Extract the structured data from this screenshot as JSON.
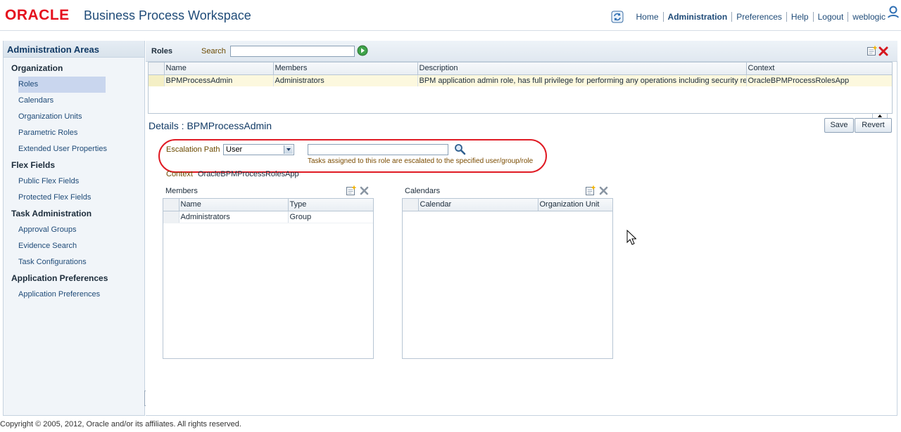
{
  "header": {
    "logo": "ORACLE",
    "app_title": "Business Process Workspace",
    "nav": {
      "home": "Home",
      "administration": "Administration",
      "preferences": "Preferences",
      "help": "Help",
      "logout": "Logout",
      "user": "weblogic"
    }
  },
  "sidebar": {
    "title": "Administration Areas",
    "sections": [
      {
        "title": "Organization",
        "items": [
          "Roles",
          "Calendars",
          "Organization Units",
          "Parametric Roles",
          "Extended User Properties"
        ]
      },
      {
        "title": "Flex Fields",
        "items": [
          "Public Flex Fields",
          "Protected Flex Fields"
        ]
      },
      {
        "title": "Task Administration",
        "items": [
          "Approval Groups",
          "Evidence Search",
          "Task Configurations"
        ]
      },
      {
        "title": "Application Preferences",
        "items": [
          "Application Preferences"
        ]
      }
    ]
  },
  "roles": {
    "title": "Roles",
    "search_label": "Search",
    "search_value": "",
    "columns": [
      "Name",
      "Members",
      "Description",
      "Context"
    ],
    "rows": [
      [
        "BPMProcessAdmin",
        "Administrators",
        "BPM application admin role, has full privilege for performing any operations including security relat",
        "OracleBPMProcessRolesApp"
      ]
    ]
  },
  "details": {
    "title": "Details : BPMProcessAdmin",
    "save_label": "Save",
    "revert_label": "Revert",
    "escalation_label": "Escalation Path",
    "escalation_value": "User",
    "escalation_input": "",
    "escalation_hint": "Tasks assigned to this role are escalated to the specified user/group/role",
    "context_label": "Context",
    "context_value": "OracleBPMProcessRolesApp"
  },
  "members": {
    "title": "Members",
    "columns": [
      "Name",
      "Type"
    ],
    "rows": [
      [
        "Administrators",
        "Group"
      ]
    ]
  },
  "calendars": {
    "title": "Calendars",
    "columns": [
      "Calendar",
      "Organization Unit"
    ],
    "rows": []
  },
  "footer": {
    "copyright": "Copyright © 2005, 2012, Oracle and/or its affiliates. All rights reserved."
  },
  "colors": {
    "oracle_red": "#e5101e",
    "brand_blue": "#1f4b78",
    "highlight_oval": "#e01b24",
    "selected_row": "#fcf8de"
  }
}
